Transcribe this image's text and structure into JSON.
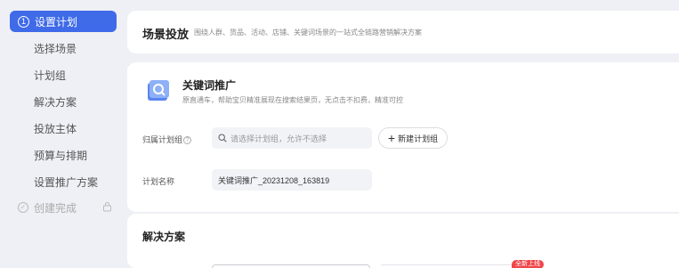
{
  "sidebar": {
    "active": {
      "num": "1",
      "label": "设置计划"
    },
    "items": [
      {
        "label": "选择场景"
      },
      {
        "label": "计划组"
      },
      {
        "label": "解决方案"
      },
      {
        "label": "投放主体"
      },
      {
        "label": "预算与排期"
      },
      {
        "label": "设置推广方案"
      }
    ],
    "last": {
      "check": "✓",
      "label": "创建完成",
      "icon": "lock-icon"
    }
  },
  "scene": {
    "title": "场景投放",
    "desc": "围绕人群、货品、活动、店铺、关键词场景的一站式全链路营销解决方案"
  },
  "keyword": {
    "icon": "keyword-promo-icon",
    "title": "关键词推广",
    "desc": "原直通车，帮助宝贝精准展现在搜索结果页，无点击不扣费，精准可控"
  },
  "form": {
    "group_label": "归属计划组",
    "help": "?",
    "search_placeholder": "请选择计划组，允许不选择",
    "new_group_label": "新建计划组",
    "plan_name_label": "计划名称",
    "plan_name_value": "关键词推广_20231208_163819"
  },
  "solution": {
    "title": "解决方案",
    "badge": "全新上线"
  },
  "colors": {
    "accent": "#3f6ae8",
    "badge": "#f0464a",
    "background": "#eef0f5"
  }
}
